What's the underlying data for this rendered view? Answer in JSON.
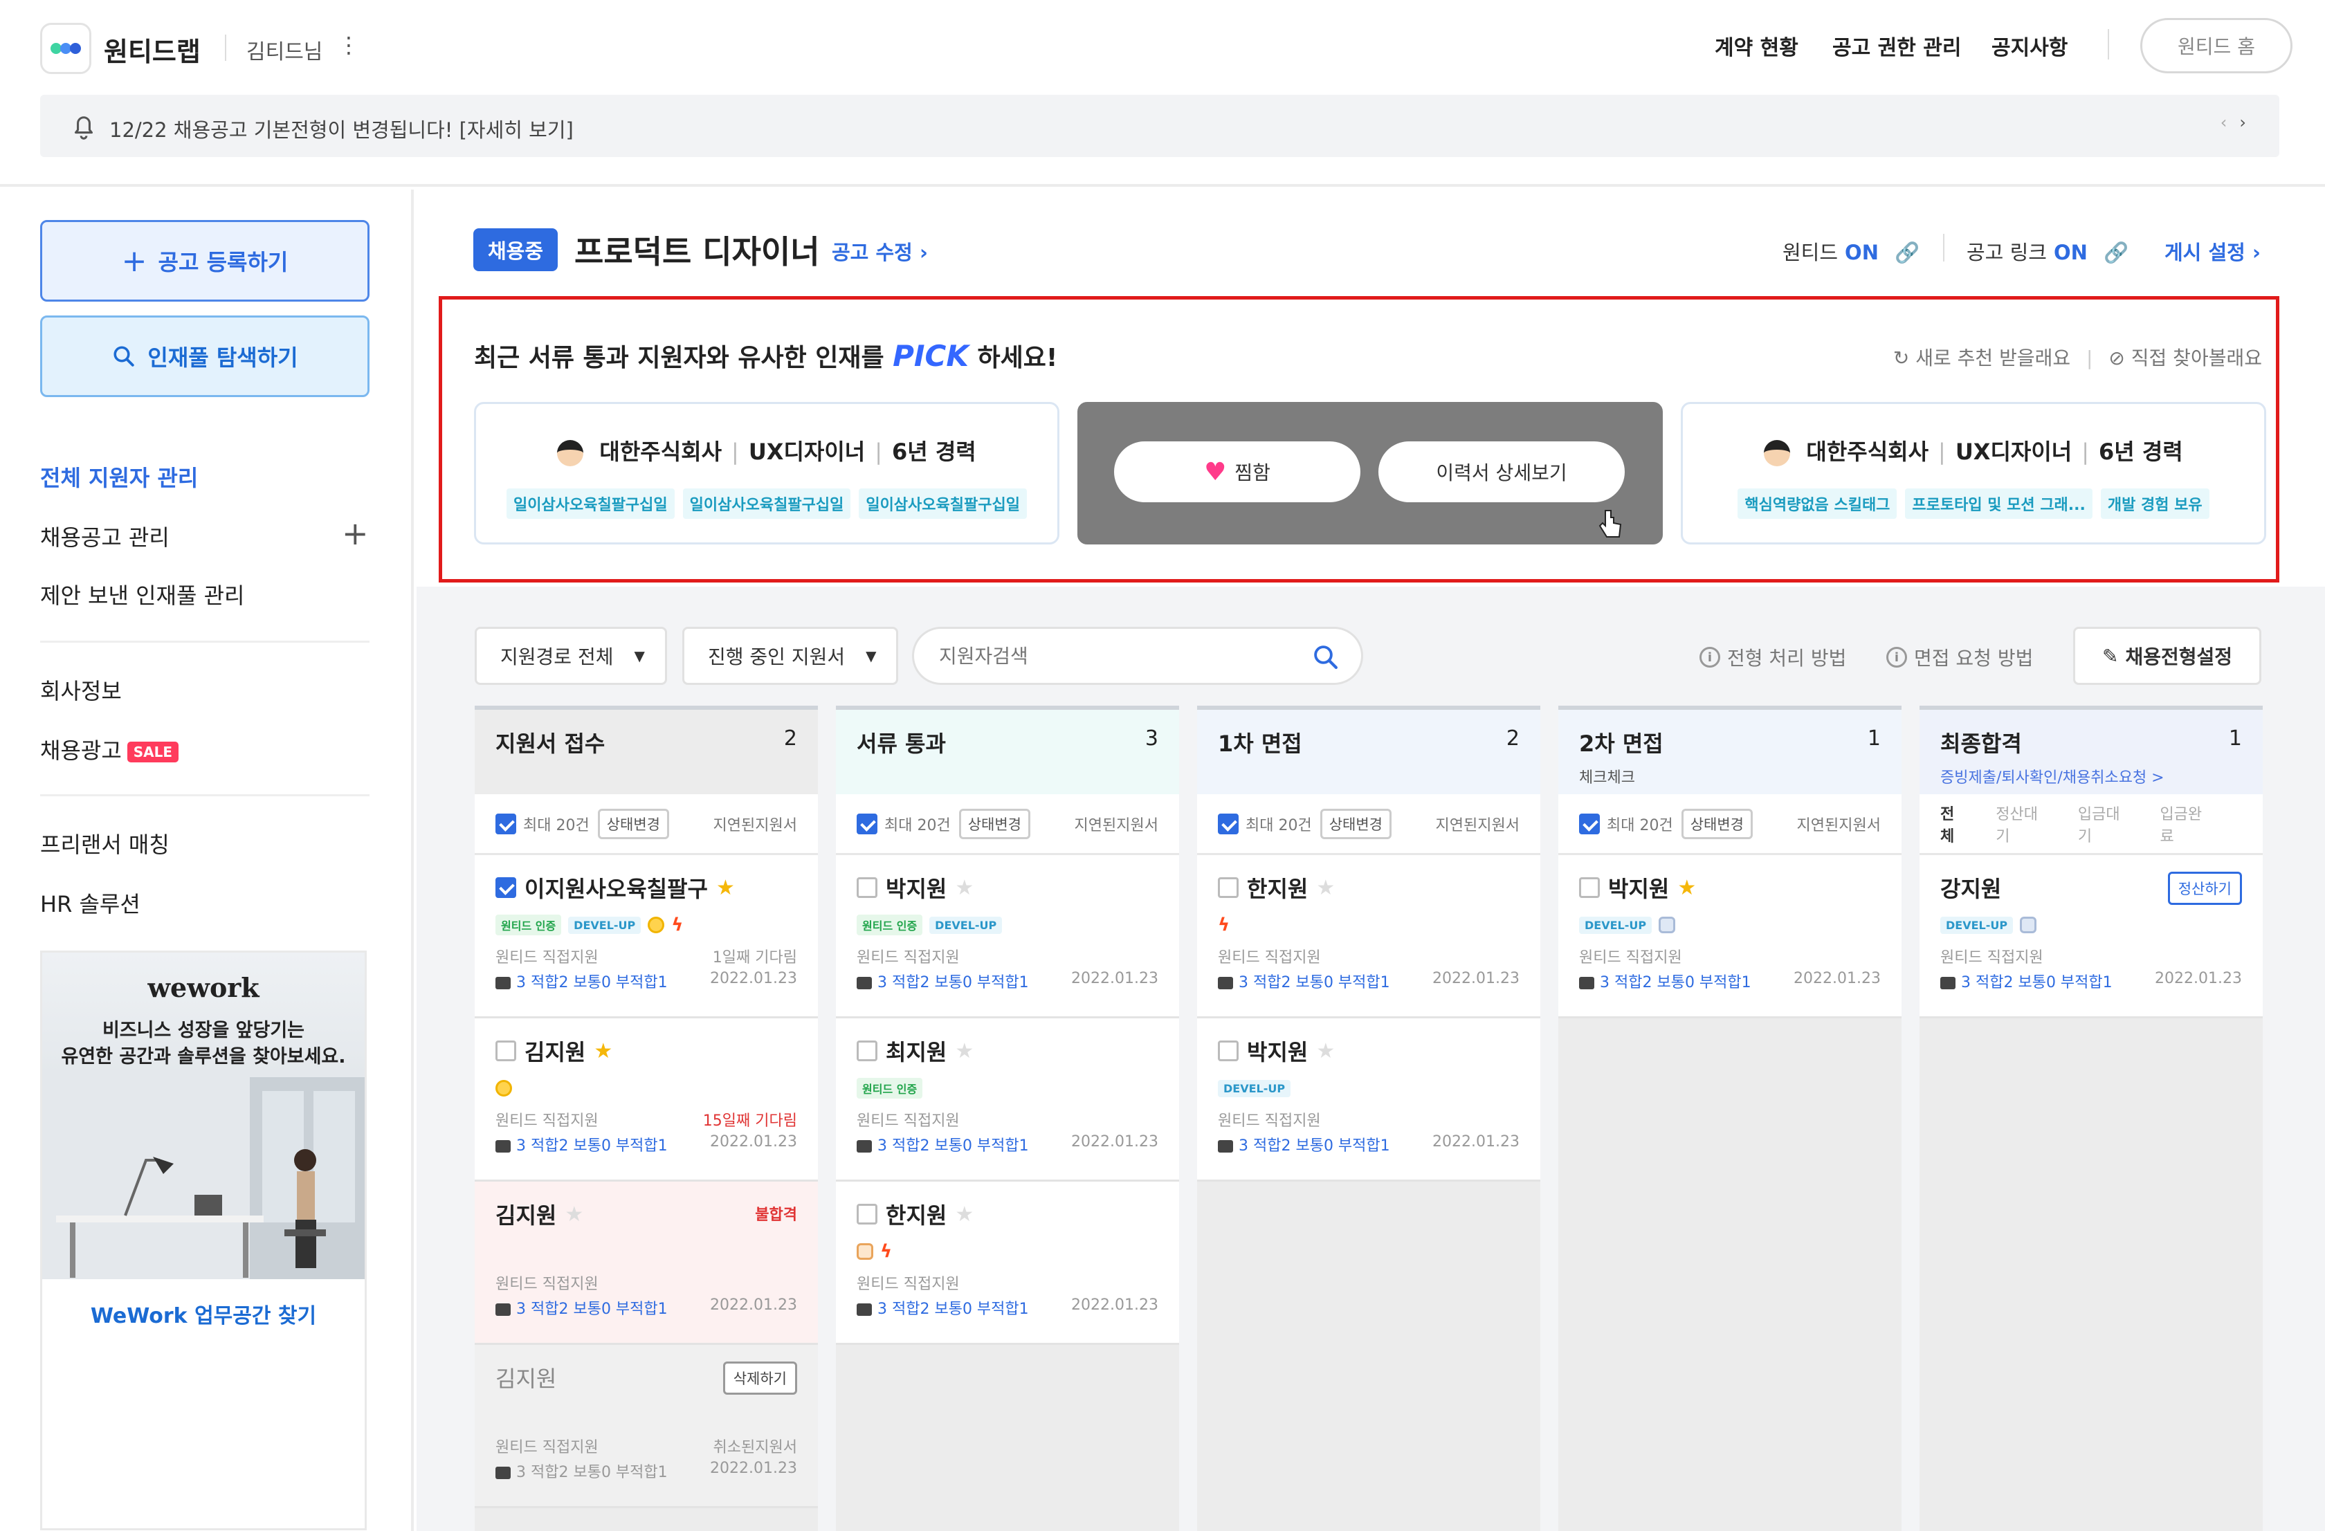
{
  "header": {
    "brand": "원티드랩",
    "user": "김티드님",
    "nav": [
      "계약 현황",
      "공고 권한 관리",
      "공지사항"
    ],
    "home_button": "원티드 홈",
    "notice": "12/22 채용공고 기본전형이 변경됩니다! [자세히 보기]",
    "colors": {
      "accent": "#2e6be0",
      "logo_dots": [
        "#3fd4a2",
        "#4a8ef5",
        "#2e5fd9"
      ]
    }
  },
  "sidebar": {
    "register_button": "공고 등록하기",
    "talent_search_button": "인재풀 탐색하기",
    "links": [
      {
        "label": "전체 지원자 관리",
        "active": true
      },
      {
        "label": "채용공고 관리"
      },
      {
        "label": "제안 보낸 인재풀 관리"
      },
      {
        "label": "회사정보"
      },
      {
        "label": "채용광고",
        "badge": "SALE"
      },
      {
        "label": "프리랜서 매칭"
      },
      {
        "label": "HR 솔루션"
      }
    ],
    "ad": {
      "brand": "wework",
      "copy_line1": "비즈니스 성장을 앞당기는",
      "copy_line2": "유연한 공간과 솔루션을 찾아보세요.",
      "link": "WeWork 업무공간 찾기"
    }
  },
  "job": {
    "status": "채용중",
    "title": "프로덕트 디자이너",
    "edit_link": "공고 수정",
    "wanted_label": "원티드",
    "wanted_state": "ON",
    "link_label": "공고 링크",
    "link_state": "ON",
    "publish_settings": "게시 설정"
  },
  "pick": {
    "title_before": "최근 서류 통과 지원자와 유사한 인재를",
    "title_highlight": "PICK",
    "title_after": "하세요!",
    "action_refresh": "새로 추천 받을래요",
    "action_direct": "직접 찾아볼래요",
    "cards": [
      {
        "company": "대한주식회사",
        "role": "UX디자이너",
        "exp": "6년 경력",
        "tags": [
          "일이삼사오육칠팔구십일",
          "일이삼사오육칠팔구십일",
          "일이삼사오육칠팔구십일"
        ]
      },
      {
        "hover_like": "찜함",
        "hover_detail": "이력서 상세보기"
      },
      {
        "company": "대한주식회사",
        "role": "UX디자이너",
        "exp": "6년 경력",
        "tags": [
          "핵심역량없음 스킬태그",
          "프로토타입 및 모션 그래...",
          "개발 경험 보유"
        ]
      }
    ]
  },
  "filters": {
    "source": "지원경로 전체",
    "stage": "진행 중인 지원서",
    "search_placeholder": "지원자검색",
    "help_process": "전형 처리 방법",
    "help_interview": "면접 요청 방법",
    "settings_button": "채용전형설정"
  },
  "columns": [
    {
      "name": "지원서 접수",
      "count": "2",
      "ctl": {
        "select": "최대 20건",
        "change": "상태변경",
        "right": "지연된지원서"
      },
      "cards": [
        {
          "name": "이지원사오육칠팔구",
          "checked": true,
          "star": true,
          "source": "원티드 직접지원",
          "delay": "1일째 기다림",
          "eval": "3 적합2 보통0 부적합1",
          "date": ""
        },
        {
          "name": "김지원",
          "star": true,
          "source": "원티드 직접지원",
          "delay": "15일째 기다림",
          "eval": "3 적합2 보통0 부적합1",
          "date": "2022.01.23"
        },
        {
          "name": "김지원",
          "fail": "불합격",
          "source": "원티드 직접지원",
          "eval": "3 적합2 보통0 부적합1",
          "date": "2022.01.23"
        },
        {
          "name": "김지원",
          "delete": "삭제하기",
          "source": "원티드 직접지원",
          "cancel": "취소된지원서",
          "eval": "3 적합2 보통0 부적합1",
          "date": "2022.01.23"
        }
      ],
      "first_date": "2022.01.23"
    },
    {
      "name": "서류 통과",
      "count": "3",
      "ctl": {
        "select": "최대 20건",
        "change": "상태변경",
        "right": "지연된지원서"
      },
      "cards": [
        {
          "name": "박지원",
          "source": "원티드 직접지원",
          "eval": "3 적합2 보통0 부적합1",
          "date": "2022.01.23"
        },
        {
          "name": "최지원",
          "source": "원티드 직접지원",
          "eval": "3 적합2 보통0 부적합1",
          "date": "2022.01.23"
        },
        {
          "name": "한지원",
          "source": "원티드 직접지원",
          "eval": "3 적합2 보통0 부적합1",
          "date": "2022.01.23"
        }
      ]
    },
    {
      "name": "1차 면접",
      "count": "2",
      "ctl": {
        "select": "최대 20건",
        "change": "상태변경",
        "right": "지연된지원서"
      },
      "cards": [
        {
          "name": "한지원",
          "source": "원티드 직접지원",
          "eval": "3 적합2 보통0 부적합1",
          "date": "2022.01.23"
        },
        {
          "name": "박지원",
          "source": "원티드 직접지원",
          "eval": "3 적합2 보통0 부적합1",
          "date": "2022.01.23"
        }
      ]
    },
    {
      "name": "2차 면접",
      "count": "1",
      "sub": "체크체크",
      "ctl": {
        "select": "최대 20건",
        "change": "상태변경",
        "right": "지연된지원서"
      },
      "cards": [
        {
          "name": "박지원",
          "star": true,
          "source": "원티드 직접지원",
          "eval": "3 적합2 보통0 부적합1",
          "date": "2022.01.23"
        }
      ]
    },
    {
      "name": "최종합격",
      "count": "1",
      "sub": "증빙제출/퇴사확인/채용취소요청 >",
      "tabs": [
        "전체",
        "정산대기",
        "입금대기",
        "입금완료"
      ],
      "cards": [
        {
          "name": "강지원",
          "settle": "정산하기",
          "source": "원티드 직접지원",
          "eval": "3 적합2 보통0 부적합1",
          "date": "2022.01.23"
        }
      ]
    }
  ],
  "badge_labels": {
    "wanted": "원티드 인증",
    "devel": "DEVEL-UP"
  }
}
